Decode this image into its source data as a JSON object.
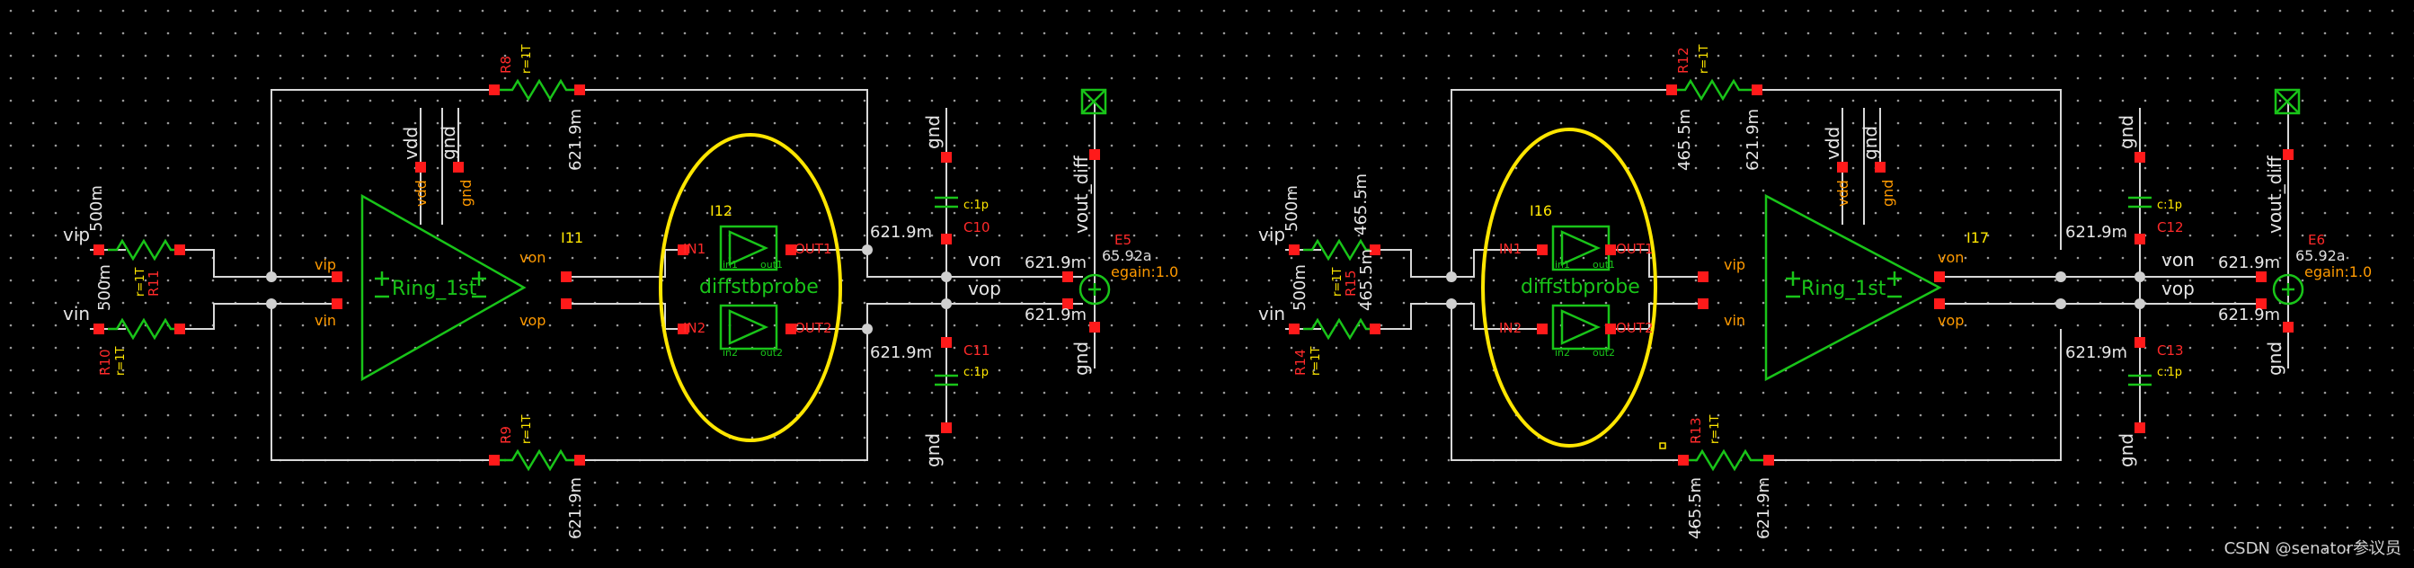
{
  "left": {
    "inst_name": "I11",
    "cell_name": "Ring_1st",
    "probe_inst": "I12",
    "probe_cell": "diffstbprobe",
    "res_top": {
      "name": "R8",
      "val": "r=1T",
      "volt": "621.9m"
    },
    "res_bot": {
      "name": "R9",
      "val": "r=1T",
      "volt": "621.9m"
    },
    "res_vip": {
      "name": "R11",
      "val": "r=1T",
      "volt": "500m"
    },
    "res_vin": {
      "name": "R10",
      "val": "r=1T",
      "volt": "500m"
    },
    "cap_top": {
      "name": "C10",
      "val": "c:1p"
    },
    "cap_bot": {
      "name": "C11",
      "val": "c:1p"
    },
    "vcvs": {
      "name": "E5",
      "gain": "egain:1.0",
      "volt": "65.92a"
    },
    "node_volt": "621.9m"
  },
  "right": {
    "inst_name": "I17",
    "cell_name": "Ring_1st",
    "probe_inst": "I16",
    "probe_cell": "diffstbprobe",
    "res_top": {
      "name": "R12",
      "val": "r=1T",
      "volt_l": "465.5m",
      "volt_r": "621.9m"
    },
    "res_bot": {
      "name": "R13",
      "val": "r=1T",
      "volt_l": "465.5m",
      "volt_r": "621.9m"
    },
    "res_vip": {
      "name": "R15",
      "val": "r=1T",
      "volt_l": "500m",
      "volt_r": "465.5m"
    },
    "res_vin": {
      "name": "R14",
      "val": "r=1T",
      "volt_l": "500m",
      "volt_r": "465.5m"
    },
    "cap_top": {
      "name": "C12",
      "val": "c:1p"
    },
    "cap_bot": {
      "name": "C13",
      "val": "c:1p"
    },
    "vcvs": {
      "name": "E6",
      "gain": "egain:1.0",
      "volt": "65.92a"
    },
    "node_volt": "621.9m"
  },
  "pins": {
    "vip": "vip",
    "vin": "vin",
    "von": "von",
    "vop": "vop",
    "vdd": "vdd",
    "gnd": "gnd",
    "vout": "vout_diff",
    "in1": "IN1",
    "in2": "IN2",
    "out1": "OUT1",
    "out2": "OUT2",
    "in1s": "in1",
    "in2s": "in2",
    "out1s": "out1",
    "out2s": "out2"
  },
  "watermark": "CSDN @senator参议员",
  "colors": {
    "wire": "#d8d8d8",
    "symbol": "#19c419",
    "pin": "#ff1a1a",
    "highlight": "#ffe600",
    "label": "#ff2a2a"
  }
}
